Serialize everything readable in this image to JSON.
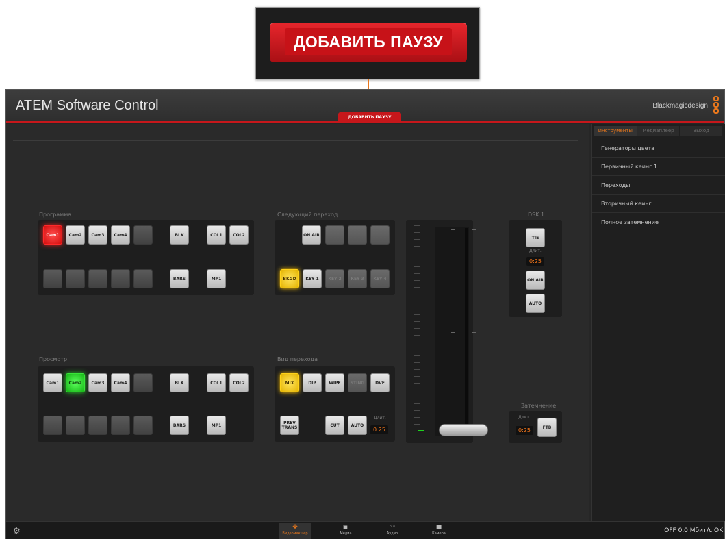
{
  "callout": {
    "label": "ДОБАВИТЬ ПАУЗУ"
  },
  "app": {
    "title": "ATEM Software Control",
    "brand": "Blackmagicdesign",
    "title_tab": "ДОБАВИТЬ ПАУЗУ"
  },
  "program": {
    "label": "Программа",
    "row1": [
      "Cam1",
      "Cam2",
      "Cam3",
      "Cam4",
      ""
    ],
    "row1_extra": [
      "BLK",
      "COL1",
      "COL2"
    ],
    "row2_extra": [
      "BARS",
      "MP1"
    ]
  },
  "preview": {
    "label": "Просмотр",
    "row1": [
      "Cam1",
      "Cam2",
      "Cam3",
      "Cam4",
      ""
    ],
    "row1_extra": [
      "BLK",
      "COL1",
      "COL2"
    ],
    "row2_extra": [
      "BARS",
      "MP1"
    ]
  },
  "next_transition": {
    "label": "Следующий переход",
    "on_air": "ON AIR",
    "row2": [
      "BKGD",
      "KEY 1",
      "KEY 2",
      "KEY 3",
      "KEY 4"
    ]
  },
  "transition_style": {
    "label": "Вид перехода",
    "row1": [
      "MIX",
      "DIP",
      "WIPE",
      "STING",
      "DVE"
    ],
    "prev_trans": "PREV TRANS",
    "cut": "CUT",
    "auto": "AUTO",
    "rate_label": "Длит.",
    "rate": "0:25"
  },
  "dsk": {
    "label": "DSK 1",
    "tie": "TIE",
    "rate_label": "Длит.",
    "rate": "0:25",
    "on_air": "ON AIR",
    "auto": "AUTO"
  },
  "ftb": {
    "label": "Затемнение",
    "rate_label": "Длит.",
    "rate": "0:25",
    "button": "FTB"
  },
  "sidebar": {
    "tabs": [
      "Инструменты",
      "Медиаплеер",
      "Выход"
    ],
    "items": [
      "Генераторы цвета",
      "Первичный кеинг 1",
      "Переходы",
      "Вторичный кеинг",
      "Полное затемнение"
    ]
  },
  "bottombar": {
    "nav": [
      {
        "label": "Видеомикшер",
        "icon": "switcher-icon"
      },
      {
        "label": "Медиа",
        "icon": "media-icon"
      },
      {
        "label": "Аудио",
        "icon": "audio-icon"
      },
      {
        "label": "Камера",
        "icon": "camera-icon"
      }
    ],
    "status": "OFF 0,0 Мбит/с OK"
  },
  "colors": {
    "accent": "#e8771c",
    "brand_red": "#c6171b",
    "program": "#ff1f1f",
    "preview": "#28d828",
    "selected": "#ffc400"
  }
}
